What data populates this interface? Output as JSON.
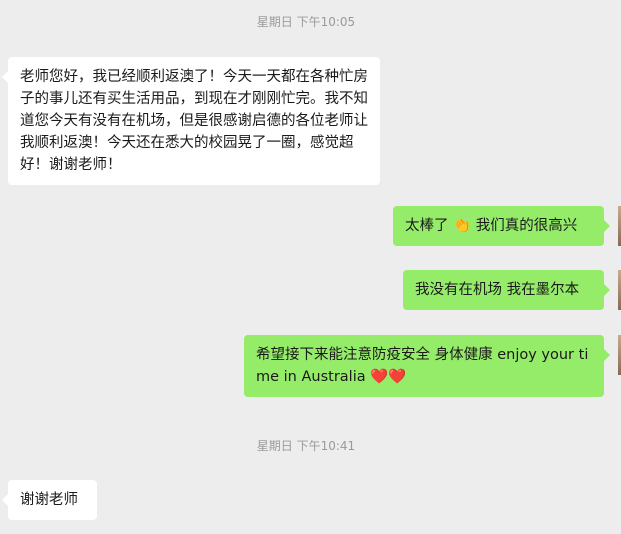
{
  "chat": {
    "timestamps": [
      "星期日 下午10:05",
      "星期日 下午10:41"
    ],
    "messages": [
      {
        "direction": "incoming",
        "text": "老师您好，我已经顺利返澳了！今天一天都在各种忙房子的事儿还有买生活用品，到现在才刚刚忙完。我不知道您今天有没有在机场，但是很感谢启德的各位老师让我顺利返澳！今天还在悉大的校园晃了一圈，感觉超好！谢谢老师！"
      },
      {
        "direction": "outgoing",
        "text": "太棒了 👏 我们真的很高兴"
      },
      {
        "direction": "outgoing",
        "text": "我没有在机场 我在墨尔本"
      },
      {
        "direction": "outgoing",
        "text": "希望接下来能注意防疫安全 身体健康 enjoy your time in Australia ❤️❤️"
      },
      {
        "direction": "incoming",
        "text": "谢谢老师"
      }
    ]
  },
  "colors": {
    "background": "#ededed",
    "incoming_bubble": "#ffffff",
    "outgoing_bubble": "#95ec69",
    "timestamp_text": "#9a9a9a"
  }
}
